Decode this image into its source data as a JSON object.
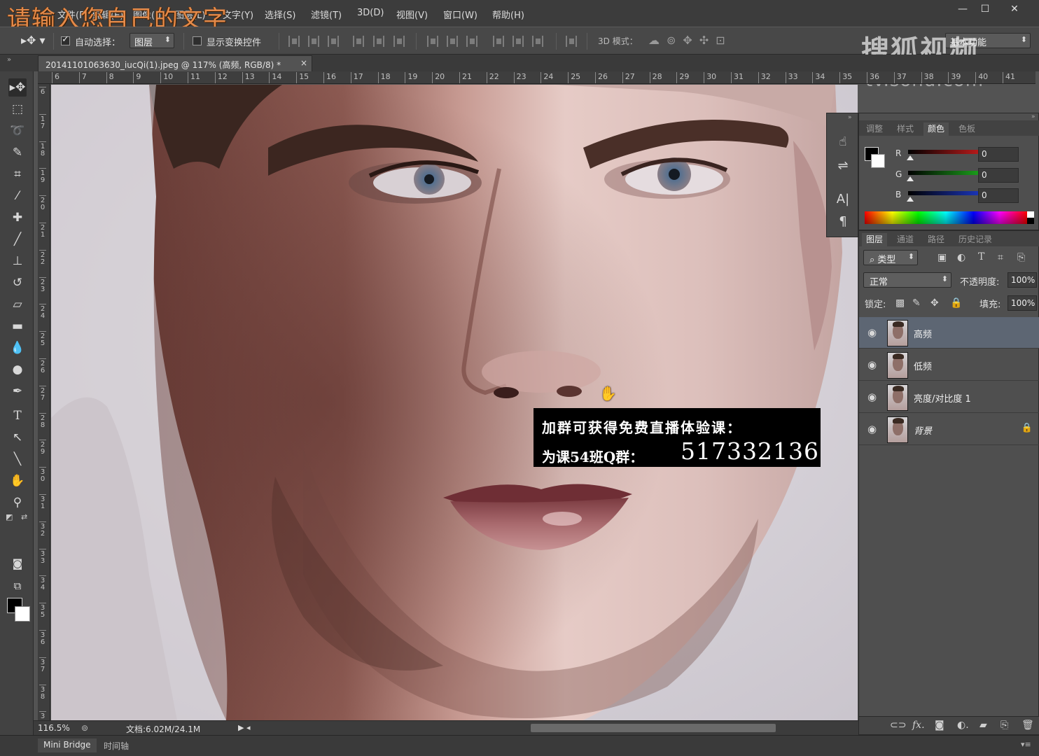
{
  "overlay_title": "请输入您自己的文字",
  "menu": {
    "items": [
      "文件(F)",
      "编辑(E)",
      "图像(I)",
      "图层(L)",
      "文字(Y)",
      "选择(S)",
      "滤镜(T)",
      "3D(D)",
      "视图(V)",
      "窗口(W)",
      "帮助(H)"
    ]
  },
  "window_controls": {
    "minimize": "—",
    "maximize": "☐",
    "close": "✕"
  },
  "options": {
    "auto_select_label": "自动选择：",
    "auto_select_checked": true,
    "auto_select_value": "图层",
    "show_transform_label": "显示变换控件",
    "show_transform_checked": false,
    "mode3d_label": "3D 模式：",
    "workspace": "基本功能"
  },
  "watermark": {
    "text": "搜狐视频",
    "sub": "tv.sohu.com"
  },
  "document": {
    "tab_title": "20141101063630_iucQi(1).jpeg @ 117% (高频, RGB/8) *",
    "close": "×"
  },
  "ruler": {
    "top_ticks": [
      "6",
      "7",
      "8",
      "9",
      "10",
      "11",
      "12",
      "13",
      "14",
      "15",
      "16",
      "17",
      "18",
      "19",
      "20",
      "21",
      "22",
      "23",
      "24",
      "25",
      "26",
      "27",
      "28",
      "29",
      "30",
      "31",
      "32",
      "33",
      "34",
      "35",
      "36",
      "37",
      "38",
      "39",
      "40",
      "41"
    ],
    "left_ticks": [
      "6",
      "1 7",
      "1 8",
      "1 9",
      "2 0",
      "2 1",
      "2 2",
      "2 3",
      "2 4",
      "2 5",
      "2 6",
      "2 7",
      "2 8",
      "2 9",
      "3 0",
      "3 1",
      "3 2",
      "3 3",
      "3 4",
      "3 5",
      "3 6",
      "3 7",
      "3 8",
      "3 9"
    ]
  },
  "tools": [
    {
      "name": "move-tool",
      "glyph": "▸✥",
      "active": true
    },
    {
      "name": "marquee-tool",
      "glyph": "⬚"
    },
    {
      "name": "lasso-tool",
      "glyph": "➰"
    },
    {
      "name": "quick-select-tool",
      "glyph": "✎"
    },
    {
      "name": "crop-tool",
      "glyph": "⌗"
    },
    {
      "name": "eyedropper-tool",
      "glyph": "⁄"
    },
    {
      "name": "healing-tool",
      "glyph": "✚"
    },
    {
      "name": "brush-tool",
      "glyph": "╱"
    },
    {
      "name": "stamp-tool",
      "glyph": "⊥"
    },
    {
      "name": "history-brush-tool",
      "glyph": "↺"
    },
    {
      "name": "eraser-tool",
      "glyph": "▱"
    },
    {
      "name": "gradient-tool",
      "glyph": "▬"
    },
    {
      "name": "blur-tool",
      "glyph": "💧"
    },
    {
      "name": "dodge-tool",
      "glyph": "●"
    },
    {
      "name": "pen-tool",
      "glyph": "✒"
    },
    {
      "name": "type-tool",
      "glyph": "T"
    },
    {
      "name": "path-select-tool",
      "glyph": "↖"
    },
    {
      "name": "line-tool",
      "glyph": "╲"
    },
    {
      "name": "hand-tool",
      "glyph": "✋"
    },
    {
      "name": "zoom-tool",
      "glyph": "⚲"
    }
  ],
  "promo": {
    "line1": "加群可获得免费直播体验课：",
    "line2_label": "为课54班Q群：",
    "line2_number": "517332136"
  },
  "status": {
    "zoom": "116.5%",
    "doc": "文档:6.02M/24.1M"
  },
  "bottom_tabs": [
    "Mini Bridge",
    "时间轴"
  ],
  "color_panel": {
    "tabs": [
      "调整",
      "样式",
      "颜色",
      "色板"
    ],
    "active_tab": "颜色",
    "channels": [
      {
        "label": "R",
        "value": "0",
        "color": "#e02020"
      },
      {
        "label": "G",
        "value": "0",
        "color": "#20c020"
      },
      {
        "label": "B",
        "value": "0",
        "color": "#2040e0"
      }
    ]
  },
  "layers_panel": {
    "tabs": [
      "图层",
      "通道",
      "路径",
      "历史记录"
    ],
    "active_tab": "图层",
    "filter_kind": "类型",
    "blend_mode": "正常",
    "opacity_label": "不透明度:",
    "opacity": "100%",
    "lock_label": "锁定:",
    "fill_label": "填充:",
    "fill": "100%",
    "layers": [
      {
        "name": "高频",
        "selected": true,
        "locked": false,
        "italic": false
      },
      {
        "name": "低频",
        "selected": false,
        "locked": false,
        "italic": false
      },
      {
        "name": "亮度/对比度 1",
        "selected": false,
        "locked": false,
        "italic": false
      },
      {
        "name": "背景",
        "selected": false,
        "locked": true,
        "italic": true
      }
    ]
  },
  "footer_icons": [
    "link-icon",
    "fx-icon",
    "mask-icon",
    "adjustment-icon",
    "folder-icon",
    "new-layer-icon",
    "trash-icon"
  ]
}
